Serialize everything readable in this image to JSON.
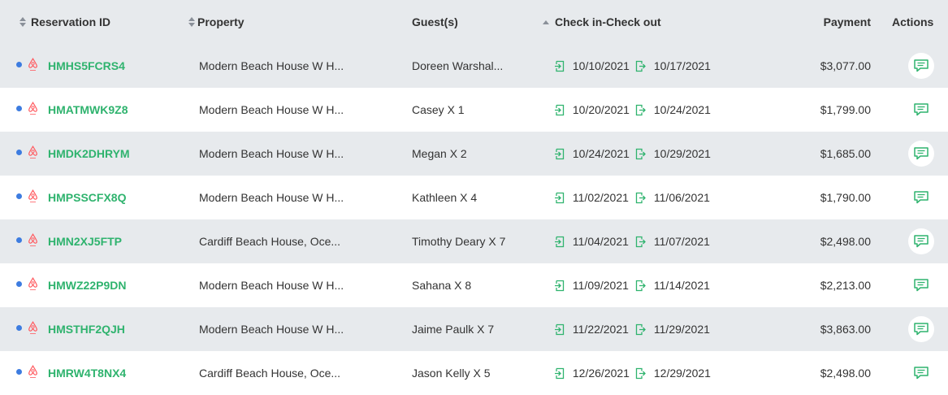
{
  "headers": {
    "reservation_id": "Reservation ID",
    "property": "Property",
    "guests": "Guest(s)",
    "checkin_checkout": "Check in-Check out",
    "payment": "Payment",
    "actions": "Actions"
  },
  "colors": {
    "accent_green": "#2fb36e",
    "status_dot_blue": "#3d7ce0",
    "airbnb_logo": "#ff5a5f"
  },
  "rows": [
    {
      "id": "HMHS5FCRS4",
      "property": "Modern Beach House W H...",
      "guests": "Doreen Warshal...",
      "checkin": "10/10/2021",
      "checkout": "10/17/2021",
      "payment": "$3,077.00"
    },
    {
      "id": "HMATMWK9Z8",
      "property": "Modern Beach House W H...",
      "guests": "Casey X 1",
      "checkin": "10/20/2021",
      "checkout": "10/24/2021",
      "payment": "$1,799.00"
    },
    {
      "id": "HMDK2DHRYM",
      "property": "Modern Beach House W H...",
      "guests": "Megan X 2",
      "checkin": "10/24/2021",
      "checkout": "10/29/2021",
      "payment": "$1,685.00"
    },
    {
      "id": "HMPSSCFX8Q",
      "property": "Modern Beach House W H...",
      "guests": "Kathleen X 4",
      "checkin": "11/02/2021",
      "checkout": "11/06/2021",
      "payment": "$1,790.00"
    },
    {
      "id": "HMN2XJ5FTP",
      "property": "Cardiff Beach House, Oce...",
      "guests": "Timothy Deary X 7",
      "checkin": "11/04/2021",
      "checkout": "11/07/2021",
      "payment": "$2,498.00"
    },
    {
      "id": "HMWZ22P9DN",
      "property": "Modern Beach House W H...",
      "guests": "Sahana X 8",
      "checkin": "11/09/2021",
      "checkout": "11/14/2021",
      "payment": "$2,213.00"
    },
    {
      "id": "HMSTHF2QJH",
      "property": "Modern Beach House W H...",
      "guests": "Jaime Paulk X 7",
      "checkin": "11/22/2021",
      "checkout": "11/29/2021",
      "payment": "$3,863.00"
    },
    {
      "id": "HMRW4T8NX4",
      "property": "Cardiff Beach House, Oce...",
      "guests": "Jason Kelly X 5",
      "checkin": "12/26/2021",
      "checkout": "12/29/2021",
      "payment": "$2,498.00"
    }
  ]
}
